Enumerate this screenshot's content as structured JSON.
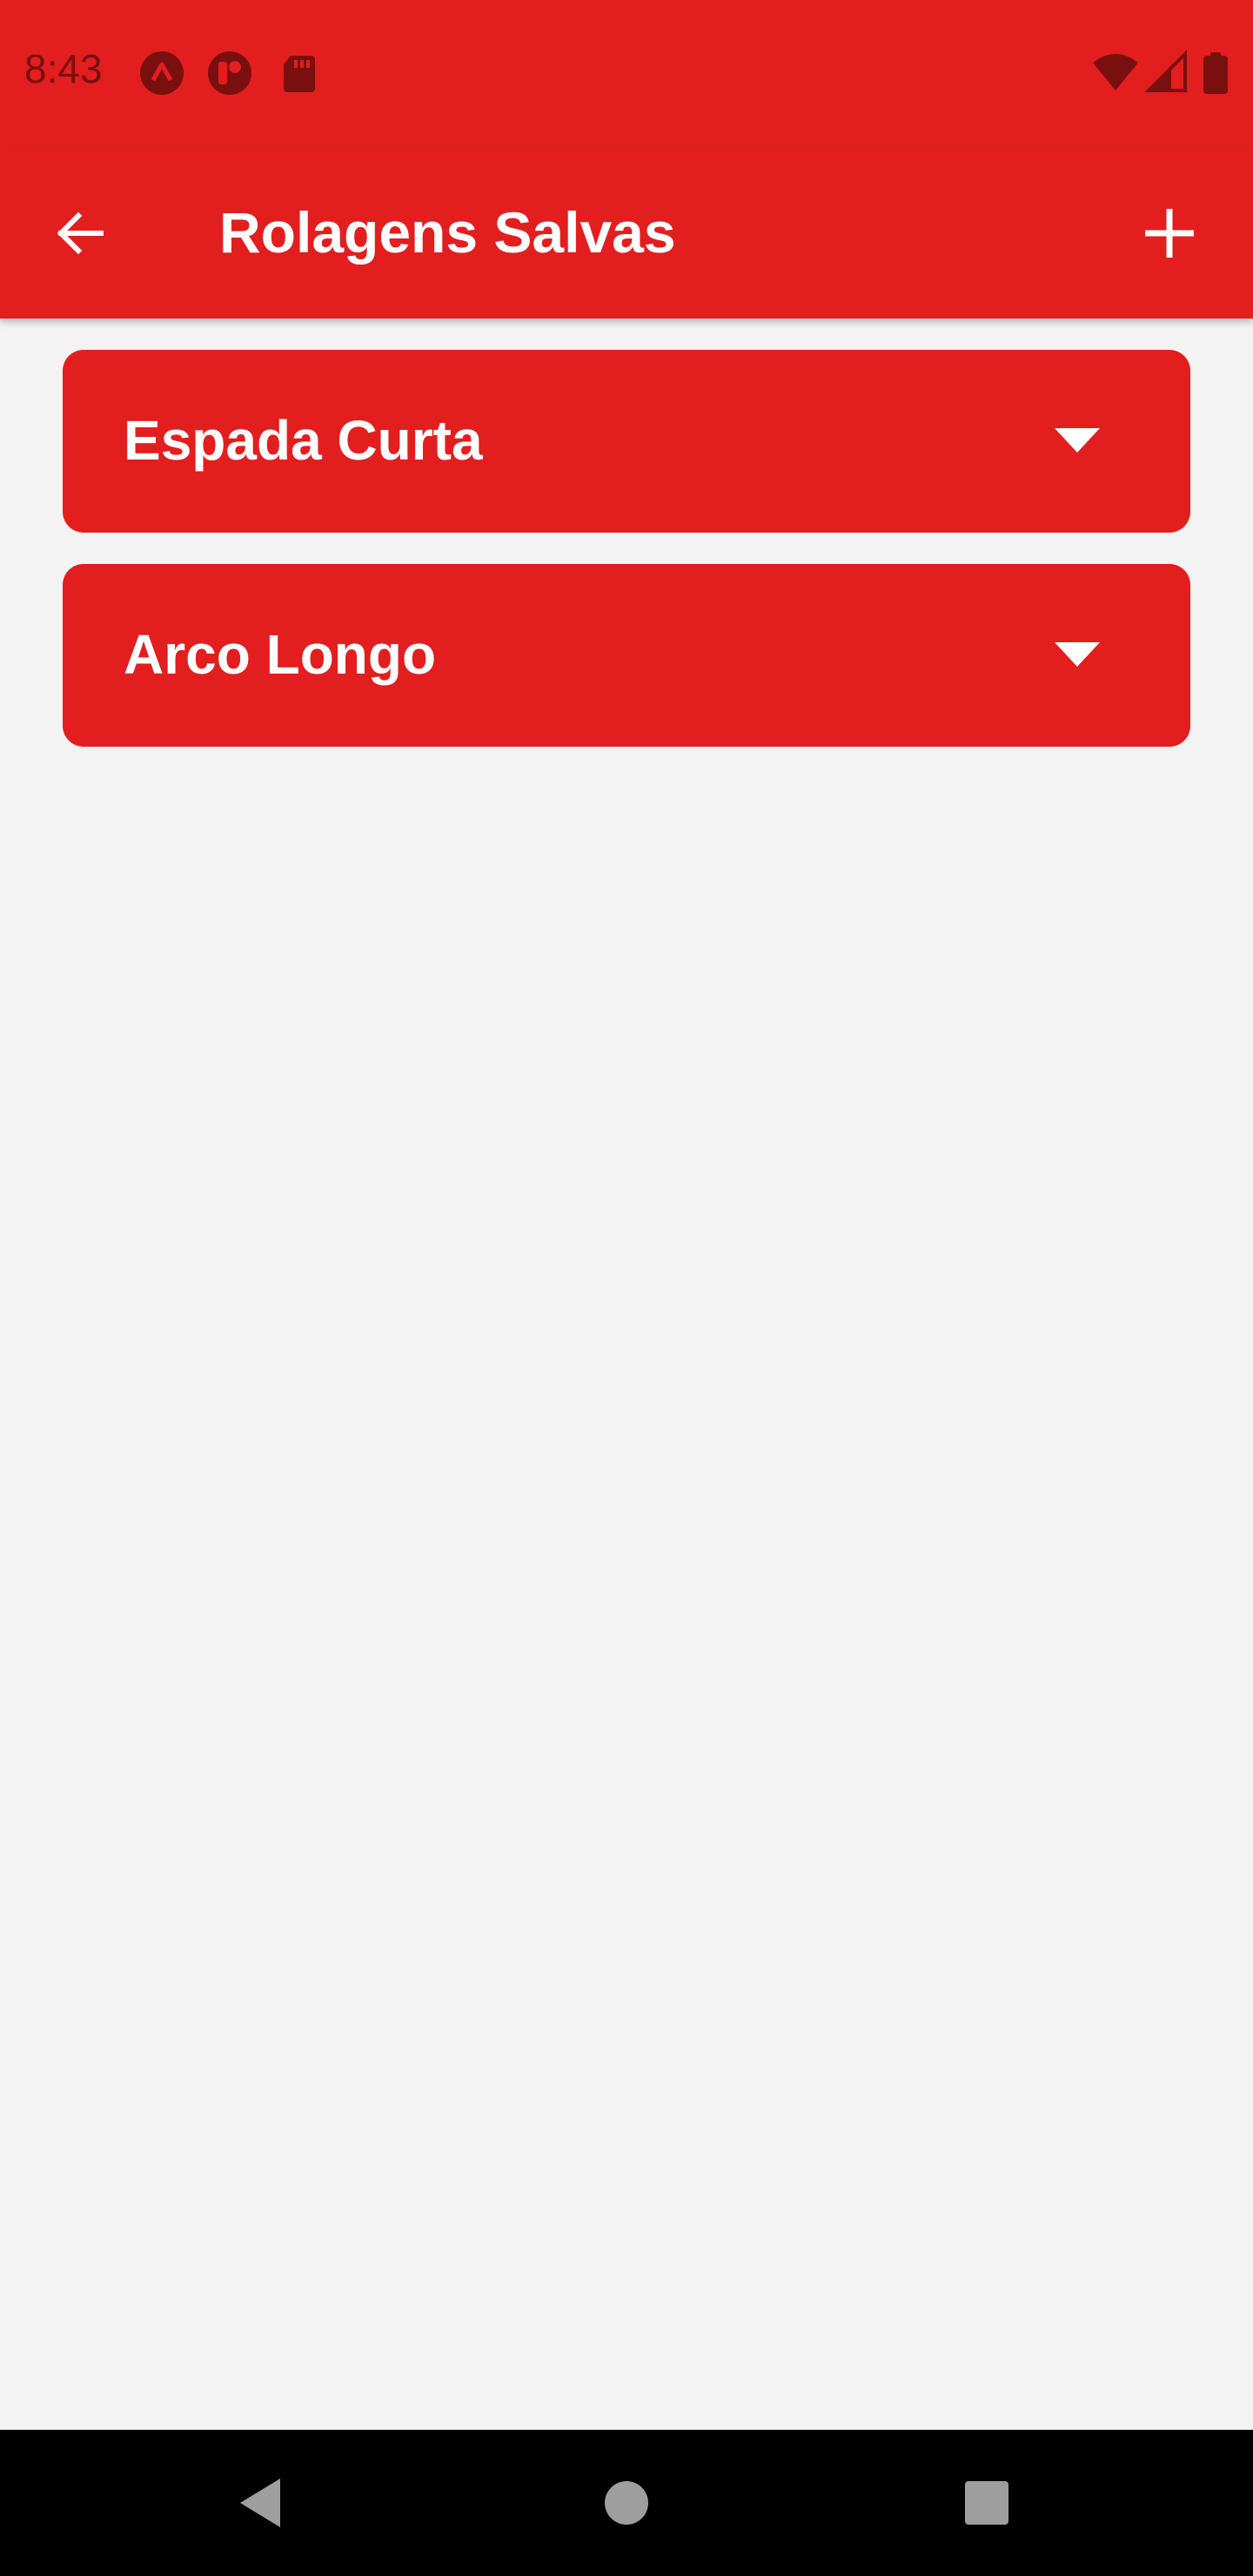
{
  "status_bar": {
    "time": "8:43",
    "icons": [
      "app-notification-icon",
      "record-notification-icon",
      "sd-card-icon",
      "wifi-icon",
      "cell-signal-icon",
      "battery-icon"
    ]
  },
  "app_bar": {
    "title": "Rolagens Salvas",
    "back_icon": "arrow-back-icon",
    "add_icon": "plus-icon"
  },
  "rolls": [
    {
      "label": "Espada Curta",
      "icon": "dropdown-arrow-icon"
    },
    {
      "label": "Arco Longo",
      "icon": "dropdown-arrow-icon"
    }
  ],
  "nav_bar": {
    "buttons": [
      "back-triangle-icon",
      "home-circle-icon",
      "recents-square-icon"
    ]
  },
  "colors": {
    "primary": "#e31e1f",
    "background": "#f3f3f3",
    "status_icon": "#7a0f10",
    "on_primary": "#ffffff",
    "nav_bar": "#000000",
    "nav_icon": "#9e9e9e"
  }
}
